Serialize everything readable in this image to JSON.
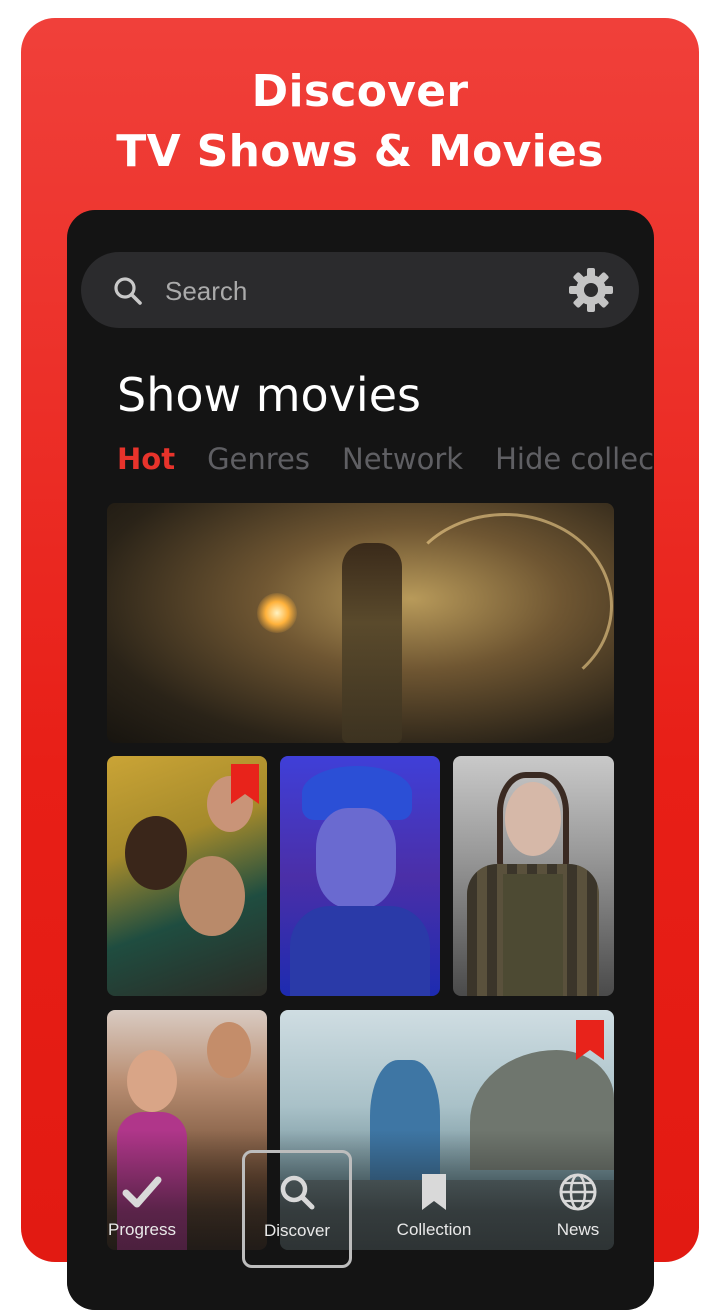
{
  "promo": {
    "headline_line1": "Discover",
    "headline_line2": "TV Shows & Movies",
    "background_color": "#e8281f"
  },
  "search": {
    "placeholder": "Search",
    "icon": "search-icon"
  },
  "settings": {
    "icon": "gear-icon"
  },
  "page": {
    "title": "Show movies"
  },
  "tabs": [
    {
      "label": "Hot",
      "active": true
    },
    {
      "label": "Genres",
      "active": false
    },
    {
      "label": "Network",
      "active": false
    },
    {
      "label": "Hide collect",
      "active": false
    }
  ],
  "cards": [
    {
      "name": "featured-movie-card",
      "bookmarked": false
    },
    {
      "name": "movie-card-1",
      "bookmarked": true
    },
    {
      "name": "movie-card-2",
      "bookmarked": false
    },
    {
      "name": "movie-card-3",
      "bookmarked": false
    },
    {
      "name": "movie-card-4",
      "bookmarked": false
    },
    {
      "name": "movie-card-5",
      "bookmarked": true
    }
  ],
  "nav": [
    {
      "label": "Progress",
      "icon": "check-icon",
      "active": false
    },
    {
      "label": "Discover",
      "icon": "search-icon",
      "active": true
    },
    {
      "label": "Collection",
      "icon": "bookmark-icon",
      "active": false
    },
    {
      "label": "News",
      "icon": "globe-icon",
      "active": false
    }
  ],
  "colors": {
    "accent": "#e8332b",
    "surface": "#141414",
    "search_bg": "#2b2b2d"
  }
}
